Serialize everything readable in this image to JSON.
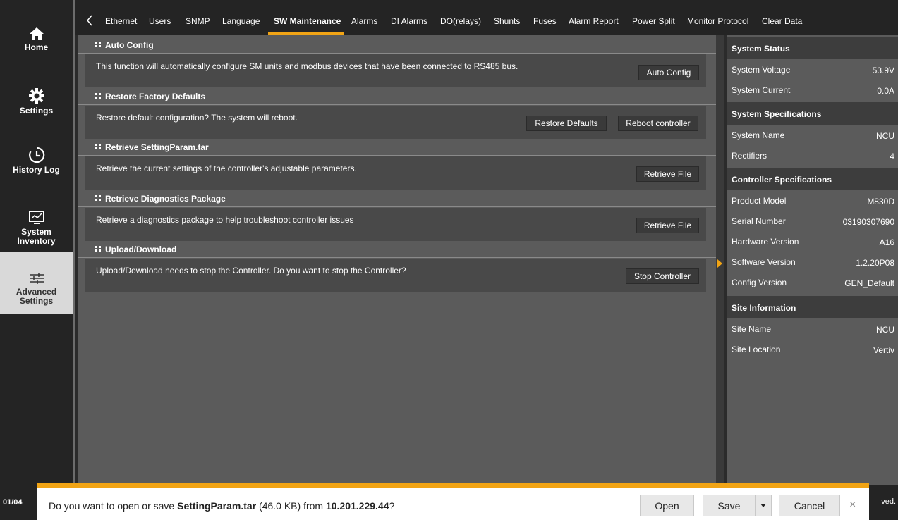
{
  "sidebar": {
    "items": [
      {
        "label": "Home",
        "icon": "home-icon"
      },
      {
        "label": "Settings",
        "icon": "gear-icon"
      },
      {
        "label": "History Log",
        "icon": "history-icon"
      },
      {
        "label": "System\nInventory",
        "icon": "monitor-icon"
      },
      {
        "label": "Advanced\nSettings",
        "icon": "sliders-icon",
        "active": true
      }
    ]
  },
  "tabs": {
    "items": [
      "Ethernet",
      "Users",
      "SNMP",
      "Language",
      "SW Maintenance",
      "Alarms",
      "DI Alarms",
      "DO(relays)",
      "Shunts",
      "Fuses",
      "Alarm Report",
      "Power Split",
      "Monitor Protocol",
      "Clear Data"
    ],
    "active": "SW Maintenance"
  },
  "sections": [
    {
      "title": "Auto Config",
      "description": "This function will automatically configure SM units and modbus devices that have been connected to RS485 bus.",
      "buttons": [
        "Auto Config"
      ]
    },
    {
      "title": "Restore Factory Defaults",
      "description": "Restore default configuration? The system will reboot.",
      "buttons": [
        "Restore Defaults",
        "Reboot controller"
      ]
    },
    {
      "title": "Retrieve SettingParam.tar",
      "description": "Retrieve the current settings of the controller's adjustable parameters.",
      "buttons": [
        "Retrieve File"
      ]
    },
    {
      "title": "Retrieve Diagnostics Package",
      "description": "Retrieve a diagnostics package to help troubleshoot controller issues",
      "buttons": [
        "Retrieve File"
      ]
    },
    {
      "title": "Upload/Download",
      "description": "Upload/Download needs to stop the Controller. Do you want to stop the Controller?",
      "buttons": [
        "Stop Controller"
      ]
    }
  ],
  "right_panel": {
    "groups": [
      {
        "title": "System Status",
        "rows": [
          {
            "key": "System Voltage",
            "value": "53.9V"
          },
          {
            "key": "System Current",
            "value": "0.0A"
          }
        ]
      },
      {
        "title": "System Specifications",
        "rows": [
          {
            "key": "System Name",
            "value": "NCU"
          },
          {
            "key": "Rectifiers",
            "value": "4"
          }
        ]
      },
      {
        "title": "Controller Specifications",
        "rows": [
          {
            "key": "Product Model",
            "value": "M830D"
          },
          {
            "key": "Serial Number",
            "value": "03190307690"
          },
          {
            "key": "Hardware Version",
            "value": "A16"
          },
          {
            "key": "Software Version",
            "value": "1.2.20P08"
          },
          {
            "key": "Config Version",
            "value": "GEN_Default"
          }
        ]
      },
      {
        "title": "Site Information",
        "rows": [
          {
            "key": "Site Name",
            "value": "NCU"
          },
          {
            "key": "Site Location",
            "value": "Vertiv"
          }
        ]
      }
    ]
  },
  "footer": {
    "date_fragment": "01/04",
    "copyright_fragment": "ved."
  },
  "download_bar": {
    "prefix": "Do you want to open or save ",
    "file_name": "SettingParam.tar",
    "size": " (46.0 KB) from ",
    "host": "10.201.229.44",
    "suffix": "?",
    "open_label": "Open",
    "save_label": "Save",
    "cancel_label": "Cancel",
    "close_glyph": "×"
  },
  "colors": {
    "accent": "#f1a415",
    "sidebar_bg": "#242424",
    "main_bg": "#5b5b5b",
    "section_body_bg": "#494949"
  }
}
